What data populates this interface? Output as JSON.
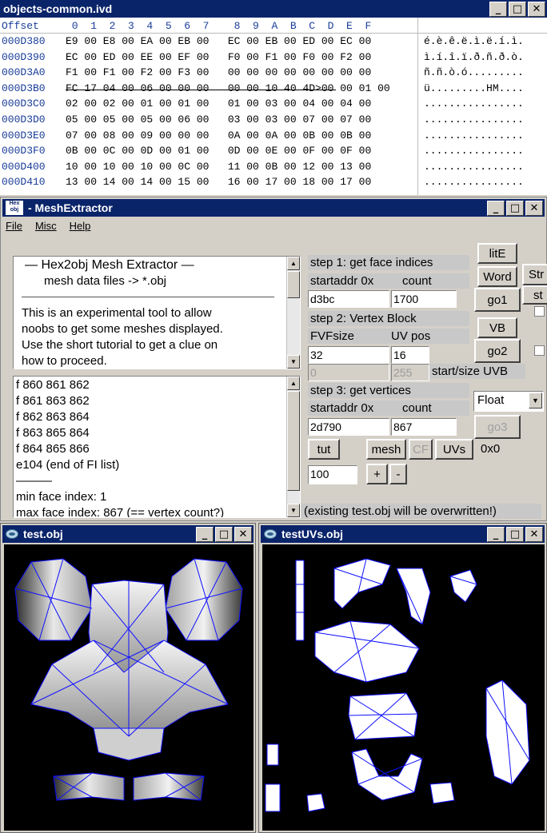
{
  "hex": {
    "title": "objects-common.ivd",
    "header_offset": "Offset",
    "header_cols": " 0  1  2  3  4  5  6  7    8  9  A  B  C  D  E  F",
    "rows": [
      {
        "off": "000D380",
        "bytes": "E9 00 E8 00 EA 00 EB 00   EC 00 EB 00 ED 00 EC 00",
        "ascii": "é.è.ê.ë.ì.ë.í.ì."
      },
      {
        "off": "000D390",
        "bytes": "EC 00 ED 00 EE 00 EF 00   F0 00 F1 00 F0 00 F2 00",
        "ascii": "ì.í.î.ï.ð.ñ.ð.ò."
      },
      {
        "off": "000D3A0",
        "bytes": "F1 00 F1 00 F2 00 F3 00   00 00 00 00 00 00 00 00",
        "ascii": "ñ.ñ.ò.ó........."
      },
      {
        "off": "000D3B0",
        "bytes": "FC 17 04 00 06 00 00 00   00 00 10 40 4D>00 00 01 00",
        "ascii": "ü.........HM...."
      },
      {
        "off": "000D3C0",
        "bytes": "02 00 02 00 01 00 01 00   01 00 03 00 04 00 04 00",
        "ascii": "................"
      },
      {
        "off": "000D3D0",
        "bytes": "05 00 05 00 05 00 06 00   03 00 03 00 07 00 07 00",
        "ascii": "................"
      },
      {
        "off": "000D3E0",
        "bytes": "07 00 08 00 09 00 00 00   0A 00 0A 00 0B 00 0B 00",
        "ascii": "................"
      },
      {
        "off": "000D3F0",
        "bytes": "0B 00 0C 00 0D 00 01 00   0D 00 0E 00 0F 00 0F 00",
        "ascii": "................"
      },
      {
        "off": "000D400",
        "bytes": "10 00 10 00 10 00 0C 00   11 00 0B 00 12 00 13 00",
        "ascii": "................"
      },
      {
        "off": "000D410",
        "bytes": "13 00 14 00 14 00 15 00   16 00 17 00 18 00 17 00",
        "ascii": "................"
      }
    ]
  },
  "mesh": {
    "title": "- MeshExtractor",
    "icon_text_top": "Hex",
    "icon_text_bottom": "obj",
    "menu": [
      "File",
      "Misc",
      "Help"
    ],
    "intro_title": "—  Hex2obj Mesh Extractor  —",
    "intro_sub": "mesh data files -> *.obj",
    "intro_body": [
      "This is an experimental tool to allow",
      "noobs to get some meshes displayed.",
      "Use the short tutorial to get a clue on",
      "how to proceed."
    ],
    "log_lines": [
      "f  860 861 862",
      "f  861 863 862",
      "f  862 863 864",
      "f  863 865 864",
      "f  864 865 866",
      "e104 (end of FI list)",
      "———",
      "min face index: 1",
      "max face index: 867 (== vertex count?)"
    ],
    "step1_label": "step 1: get face indices",
    "step1_cols": [
      "startaddr 0x",
      "count"
    ],
    "step1_addr": "d3bc",
    "step1_count": "1700",
    "btn_lite": "litE",
    "btn_word": "Word",
    "btn_go1": "go1",
    "btn_str_a": "Str",
    "btn_str_b": "st",
    "step2_label": "step 2: Vertex Block",
    "step2_cols": [
      "FVFsize",
      "UV pos"
    ],
    "fvf_size": "32",
    "uv_pos": "16",
    "uvb_start": "0",
    "uvb_size": "255",
    "uvb_label": "start/size UVB",
    "btn_vb": "VB",
    "btn_go2": "go2",
    "step3_label": "step 3: get vertices",
    "step3_cols": [
      "startaddr 0x",
      "count"
    ],
    "step3_addr": "2d790",
    "step3_count": "867",
    "format_selected": "Float",
    "btn_go3": "go3",
    "btn_tut": "tut",
    "btn_mesh": "mesh",
    "btn_cf": "CF",
    "btn_uvs": "UVs",
    "hex_readout": "0x0",
    "scale_value": "100",
    "btn_plus": "+",
    "btn_minus": "-",
    "status": "(existing test.obj will be overwritten!)"
  },
  "viewers": {
    "left_title": "test.obj",
    "right_title": "testUVs.obj"
  },
  "colors": {
    "titlebar": "#0a246a",
    "wire": "#1010ff",
    "offset_blue": "#1a3d9a"
  }
}
